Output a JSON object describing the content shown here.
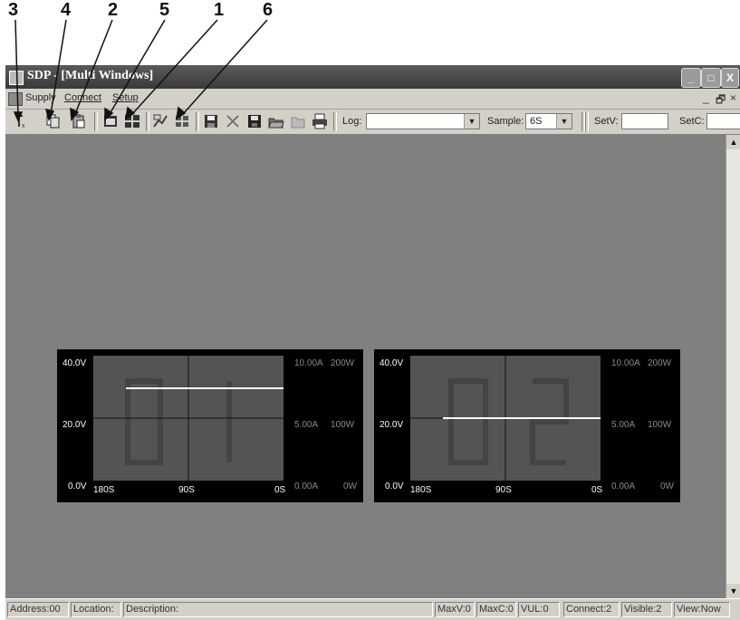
{
  "callouts": [
    "3",
    "4",
    "2",
    "5",
    "1",
    "6"
  ],
  "window": {
    "title": "SDP - [Multi Windows]",
    "min_glyph": "_",
    "max_glyph": "□",
    "close_glyph": "X"
  },
  "menu": {
    "items": [
      "Supply",
      "Connect",
      "Setup"
    ],
    "mdi_min": "_",
    "mdi_restore": "🗗",
    "mdi_close": "×"
  },
  "toolbar": {
    "buttons": [
      "tx-icon",
      "copy-icon",
      "paste-icon",
      "single-window-icon",
      "multi-window-icon",
      "chart-icon",
      "grid-icon",
      "save-icon",
      "delete-icon",
      "save-as-icon",
      "open-icon",
      "folder-icon",
      "print-icon"
    ],
    "log_label": "Log:",
    "log_value": "",
    "sample_label": "Sample:",
    "sample_value": "6S",
    "setv_label": "SetV:",
    "setv_value": "",
    "setc_label": "SetC:",
    "setc_value": ""
  },
  "panels": [
    {
      "digits": "01",
      "v_labels": [
        "40.0V",
        "20.0V",
        "0.0V"
      ],
      "a_labels": [
        "10.00A",
        "5.00A",
        "0.00A"
      ],
      "w_labels": [
        "200W",
        "100W",
        "0W"
      ],
      "time_labels": [
        "180S",
        "90S",
        "0S"
      ],
      "trace_level": 0.74,
      "trace_start": 0.17
    },
    {
      "digits": "02",
      "v_labels": [
        "40.0V",
        "20.0V",
        "0.0V"
      ],
      "a_labels": [
        "10.00A",
        "5.00A",
        "0.00A"
      ],
      "w_labels": [
        "200W",
        "100W",
        "0W"
      ],
      "time_labels": [
        "180S",
        "90S",
        "0S"
      ],
      "trace_level": 0.5,
      "trace_start": 0.17
    }
  ],
  "status": {
    "address": "Address:00",
    "location": "Location:",
    "description": "Description:",
    "maxv": "MaxV:0",
    "maxc": "MaxC:0",
    "vul": "VUL:0",
    "connect": "Connect:2",
    "visible": "Visible:2",
    "view": "View:Now"
  },
  "colors": {
    "client_bg": "#808080",
    "panel_bg": "#000000",
    "plot_bg": "#545454",
    "trace": "#ffffff"
  }
}
